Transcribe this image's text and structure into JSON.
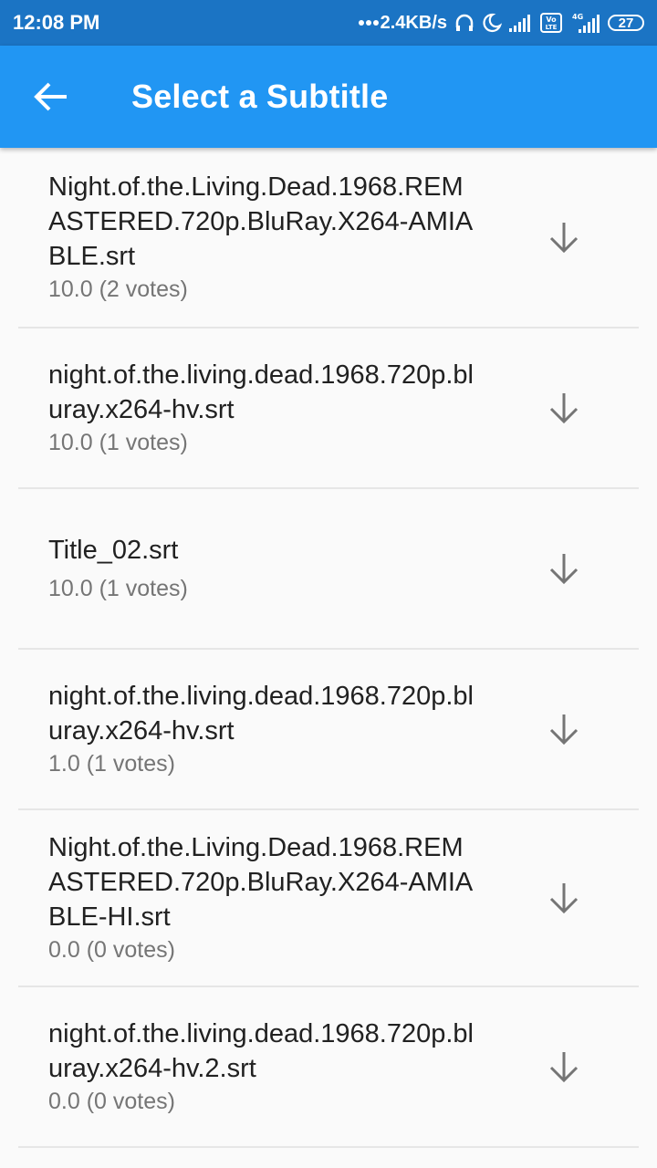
{
  "status_bar": {
    "time": "12:08 PM",
    "network_speed": "2.4KB/s",
    "icons": [
      "dots-icon",
      "headphones-icon",
      "moon-icon",
      "signal-icon",
      "volte-icon",
      "4g-signal-icon",
      "battery-icon"
    ],
    "network_type": "4G",
    "volte_label": "Vo LTE",
    "battery_level": "27"
  },
  "app_bar": {
    "title": "Select a Subtitle",
    "back_icon": "arrow-back-icon",
    "background": "#2196f3"
  },
  "subtitles": [
    {
      "title": "Night.of.the.Living.Dead.1968.REMASTERED.720p.BluRay.X264-AMIABLE.srt",
      "rating": "10.0 (2 votes)"
    },
    {
      "title": "night.of.the.living.dead.1968.720p.bluray.x264-hv.srt",
      "rating": "10.0 (1 votes)"
    },
    {
      "title": "Title_02.srt",
      "rating": "10.0 (1 votes)"
    },
    {
      "title": "night.of.the.living.dead.1968.720p.bluray.x264-hv.srt",
      "rating": "1.0 (1 votes)"
    },
    {
      "title": "Night.of.the.Living.Dead.1968.REMASTERED.720p.BluRay.X264-AMIABLE-HI.srt",
      "rating": "0.0 (0 votes)"
    },
    {
      "title": "night.of.the.living.dead.1968.720p.bluray.x264-hv.2.srt",
      "rating": "0.0 (0 votes)"
    }
  ],
  "download_icon": "arrow-downward-icon"
}
